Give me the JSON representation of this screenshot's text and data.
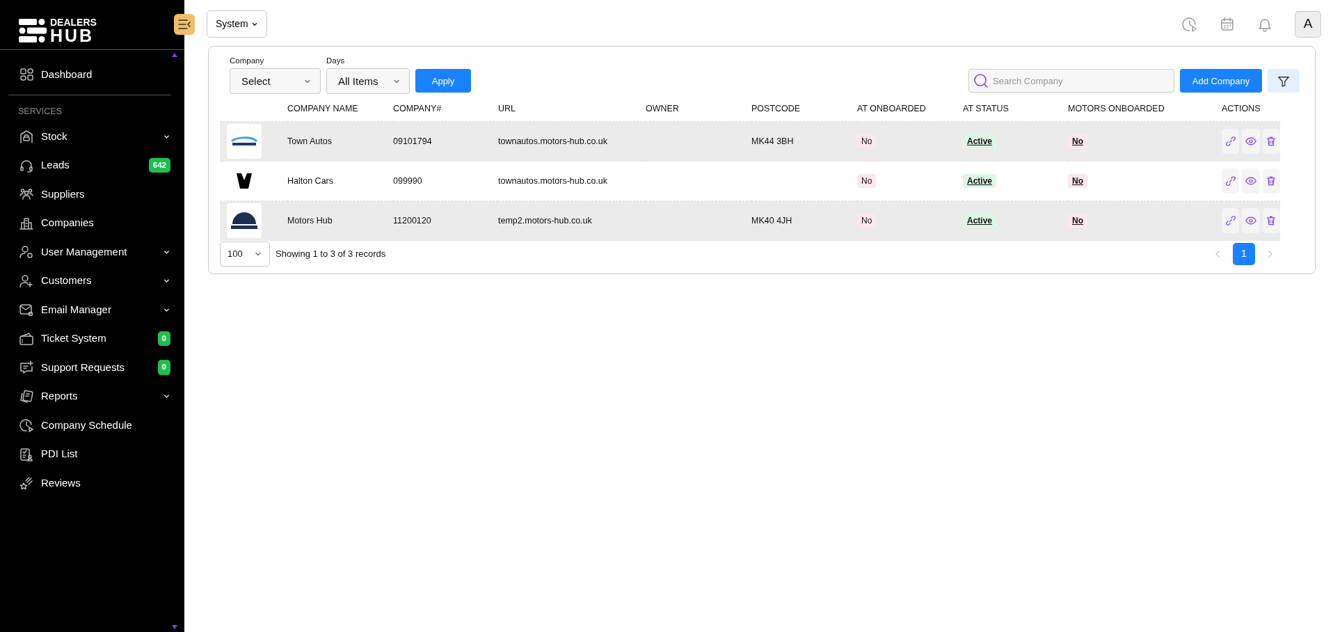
{
  "brand": {
    "line_1": "DEALERS",
    "line_2": "HUB"
  },
  "sidebar": {
    "top_items": [
      {
        "label": "Dashboard",
        "expandable": false
      }
    ],
    "section_title": "SERVICES",
    "items": [
      {
        "label": "Stock",
        "expandable": true
      },
      {
        "label": "Leads",
        "badge": "642"
      },
      {
        "label": "Suppliers",
        "expandable": false
      },
      {
        "label": "Companies",
        "expandable": false
      },
      {
        "label": "User Management",
        "expandable": true
      },
      {
        "label": "Customers",
        "expandable": true
      },
      {
        "label": "Email Manager",
        "expandable": true
      },
      {
        "label": "Ticket System",
        "badge": "0"
      },
      {
        "label": "Support Requests",
        "badge": "0"
      },
      {
        "label": "Reports",
        "expandable": true
      },
      {
        "label": "Company Schedule",
        "expandable": false
      },
      {
        "label": "PDI List",
        "expandable": false
      },
      {
        "label": "Reviews",
        "expandable": false
      }
    ]
  },
  "topbar": {
    "system_menu": "System",
    "avatar": "A"
  },
  "filters": {
    "company": {
      "label": "Company",
      "value": "Select"
    },
    "days": {
      "label": "Days",
      "value": "All Items"
    },
    "apply": "Apply"
  },
  "search": {
    "placeholder": "Search Company"
  },
  "add_button": "Add Company",
  "table": {
    "columns": [
      "COMPANY NAME",
      "COMPANY#",
      "URL",
      "OWNER",
      "POSTCODE",
      "AT ONBOARDED",
      "AT STATUS",
      "MOTORS ONBOARDED",
      "ACTIONS"
    ],
    "rows": [
      {
        "name": "Town Autos",
        "number": "09101794",
        "url": "townautos.motors-hub.co.uk",
        "postcode": "MK44 3BH",
        "at_onboarded": {
          "text": "No",
          "kind": "negative"
        },
        "at_status": {
          "text": "Active",
          "kind": "positive"
        },
        "motors_onboarded": {
          "text": "No",
          "kind": "negative"
        }
      },
      {
        "name": "Halton Cars",
        "number": "099990",
        "url": "townautos.motors-hub.co.uk",
        "at_onboarded": {
          "text": "No",
          "kind": "negative"
        },
        "at_status": {
          "text": "Active",
          "kind": "positive"
        },
        "motors_onboarded": {
          "text": "No",
          "kind": "negative"
        }
      },
      {
        "name": "Motors Hub",
        "number": "11200120",
        "url": "temp2.motors-hub.co.uk",
        "postcode": "MK40 4JH",
        "at_onboarded": {
          "text": "No",
          "kind": "negative"
        },
        "at_status": {
          "text": "Active",
          "kind": "positive"
        },
        "motors_onboarded": {
          "text": "No",
          "kind": "negative"
        }
      }
    ]
  },
  "footer": {
    "page_size": "100",
    "summary": "Showing 1 to 3 of 3 records",
    "previous_disabled": true,
    "next_disabled": true,
    "pages": [
      {
        "label": "1",
        "selected": true
      }
    ]
  }
}
